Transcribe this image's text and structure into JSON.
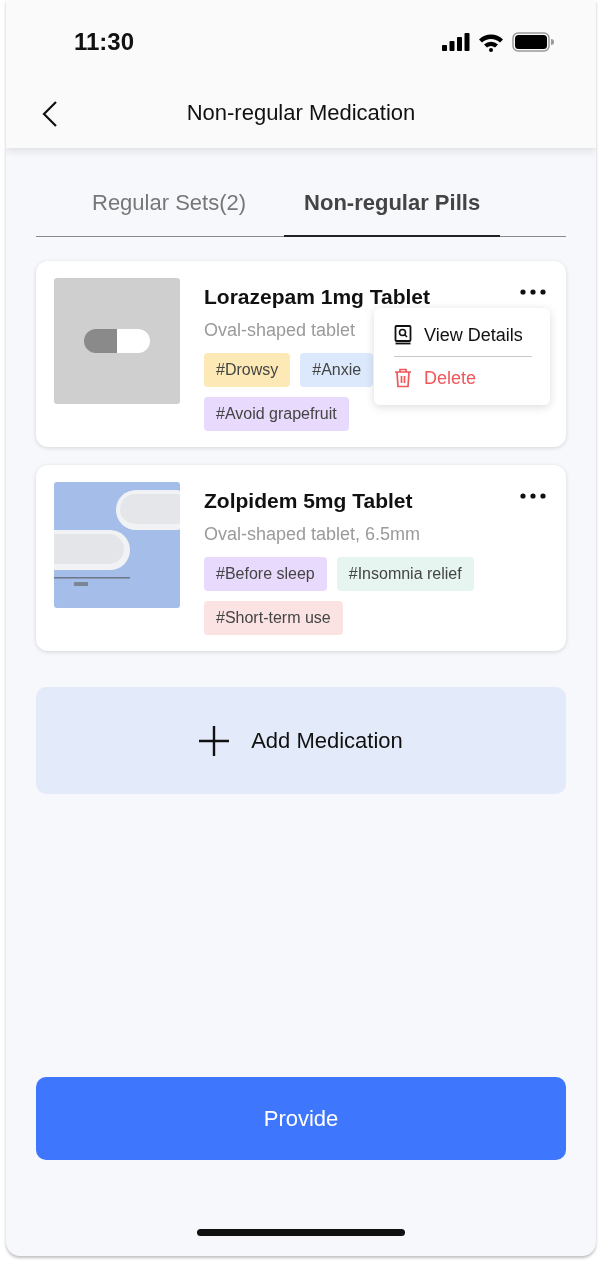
{
  "status_bar": {
    "time": "11:30"
  },
  "header": {
    "title": "Non-regular Medication"
  },
  "tabs": [
    {
      "label": "Regular Sets(2)",
      "selected": false
    },
    {
      "label": "Non-regular Pills",
      "selected": true
    }
  ],
  "medications": [
    {
      "name": "Lorazepam 1mg Tablet",
      "description": "Oval-shaped tablet",
      "image": {
        "kind": "placeholder"
      },
      "menu_open": true,
      "menu": [
        {
          "label": "View Details",
          "kind": "view"
        },
        {
          "label": "Delete",
          "kind": "delete"
        }
      ],
      "tags": [
        {
          "label": "#Drowsy",
          "color": "#fde9b5"
        },
        {
          "label": "#Anxie",
          "color": "#dce9fc"
        },
        {
          "label": "#Avoid grapefruit",
          "color": "#e8dafc"
        }
      ]
    },
    {
      "name": "Zolpidem 5mg Tablet",
      "description": "Oval-shaped tablet, 6.5mm",
      "menu_open": false,
      "tags": [
        {
          "label": "#Before sleep",
          "color": "#e8dafc"
        },
        {
          "label": "#Insomnia relief",
          "color": "#e6f5ef"
        },
        {
          "label": "#Short-term use",
          "color": "#fbe3e3"
        }
      ]
    }
  ],
  "add_button": {
    "label": "Add Medication"
  },
  "primary_button": {
    "label": "Provide"
  }
}
